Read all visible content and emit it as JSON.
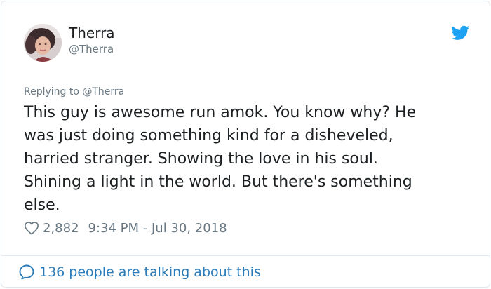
{
  "author": {
    "display_name": "Therra",
    "handle": "@Therra"
  },
  "replying_to": "Replying to @Therra",
  "tweet": {
    "text_lines": [
      "This guy is awesome run amok. You know why? He",
      "was just doing something kind for a disheveled,",
      "harried stranger. Showing the love in his soul.",
      "Shining a light in the world. But there's something",
      "else."
    ]
  },
  "meta": {
    "like_count": "2,882",
    "timestamp": "9:34 PM - Jul 30, 2018"
  },
  "footer": {
    "talking_label": "136 people are talking about this"
  },
  "icons": {
    "brand": "twitter-bird-icon",
    "like": "heart-icon",
    "conversation": "speech-bubble-icon"
  },
  "colors": {
    "twitter_blue": "#1da1f2",
    "link_blue": "#2b7bb9",
    "secondary_text": "#697882",
    "primary_text": "#1c2022",
    "border": "#e1e8ed"
  }
}
